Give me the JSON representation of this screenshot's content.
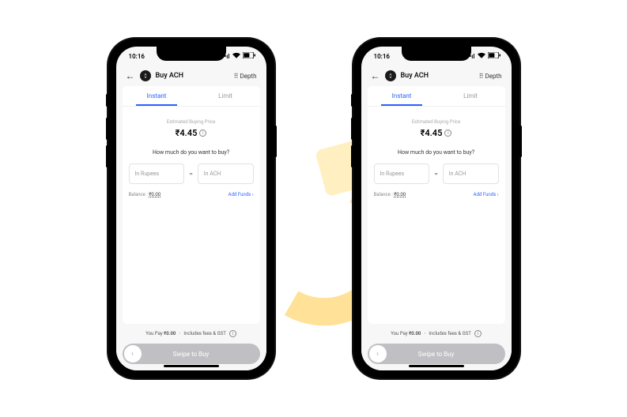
{
  "status": {
    "time": "10:16",
    "signal": "••",
    "wifi": "wifi",
    "battery": "batt"
  },
  "header": {
    "title": "Buy ACH",
    "depth": "Depth"
  },
  "tabs": {
    "instant": "Instant",
    "limit": "Limit"
  },
  "price": {
    "label": "Estimated Buying Price",
    "value": "₹4.45"
  },
  "question": "How much do you want to buy?",
  "inputs": {
    "rupees": "In Rupees",
    "eq": "=",
    "ach": "In ACH"
  },
  "balance": {
    "label": "Balance : ",
    "value": "₹0.00",
    "add": "Add Funds"
  },
  "pay": {
    "label": "You Pay ",
    "value": "₹0.00",
    "inc": "Includes fees & GST"
  },
  "swipe": "Swipe to Buy"
}
